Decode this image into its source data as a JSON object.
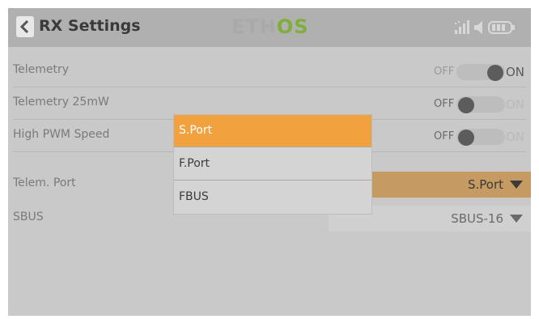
{
  "header": {
    "title": "RX Settings",
    "logo_part1": "ETH",
    "logo_part2": "OS"
  },
  "settings": {
    "telemetry": {
      "label": "Telemetry",
      "off_label": "OFF",
      "on_label": "ON",
      "value": "ON"
    },
    "telemetry_25mw": {
      "label": "Telemetry 25mW",
      "off_label": "OFF",
      "on_label": "ON",
      "value": "OFF"
    },
    "high_pwm": {
      "label": "High PWM Speed",
      "off_label": "OFF",
      "on_label": "ON",
      "value": "OFF"
    },
    "telem_port": {
      "label": "Telem. Port",
      "value": "S.Port"
    },
    "sbus": {
      "label": "SBUS",
      "value": "SBUS-16"
    }
  },
  "dropdown": {
    "options": [
      "S.Port",
      "F.Port",
      "FBUS"
    ],
    "selected": "S.Port"
  },
  "colors": {
    "accent": "#f2a13f",
    "screen_bg": "#c9c9c9",
    "header_bg": "#b0b0b0",
    "logo_green": "#7fae3a"
  },
  "icons": {
    "back": "chevron-left-icon",
    "signal": "signal-bars-icon",
    "speaker": "speaker-icon",
    "battery": "battery-icon",
    "caret": "caret-down-icon"
  }
}
